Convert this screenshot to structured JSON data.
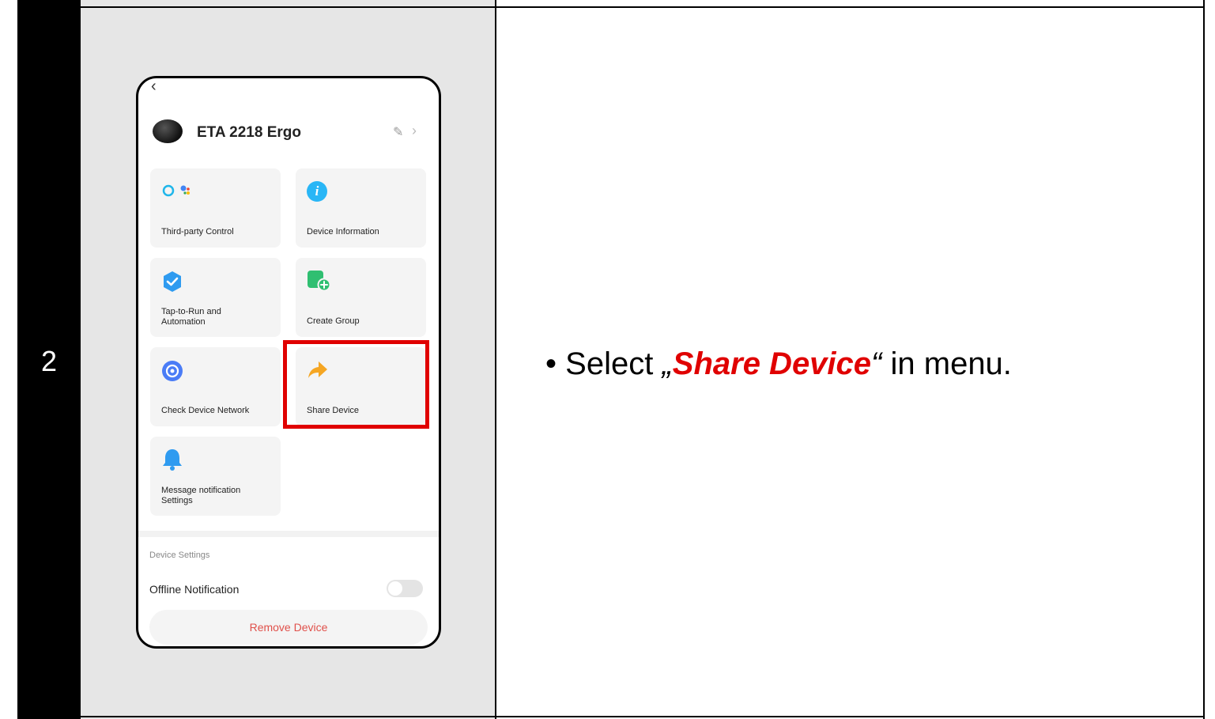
{
  "step": {
    "number": "2"
  },
  "instruction": {
    "bullet": "•",
    "prefix": "Select",
    "quote_open": "„",
    "highlight": "Share Device",
    "quote_close": "“",
    "suffix": "in menu.",
    "highlight_color": "#e00000"
  },
  "phone": {
    "back_icon": "chevron-left-icon",
    "device_name": "ETA 2218 Ergo",
    "tiles": [
      {
        "label": "Third-party Control",
        "icon": "voice-assistant-icon"
      },
      {
        "label": "Device Information",
        "icon": "info-icon"
      },
      {
        "label": "Tap-to-Run and Automation",
        "icon": "automation-check-icon"
      },
      {
        "label": "Create Group",
        "icon": "create-group-icon"
      },
      {
        "label": "Check Device Network",
        "icon": "network-icon"
      },
      {
        "label": "Share Device",
        "icon": "share-arrow-icon"
      },
      {
        "label": "Message notification Settings",
        "icon": "bell-icon"
      }
    ],
    "section_title": "Device Settings",
    "offline_notification": "Offline Notification",
    "offline_toggle_on": false,
    "remove_button": "Remove Device",
    "remove_color": "#e0504a"
  }
}
